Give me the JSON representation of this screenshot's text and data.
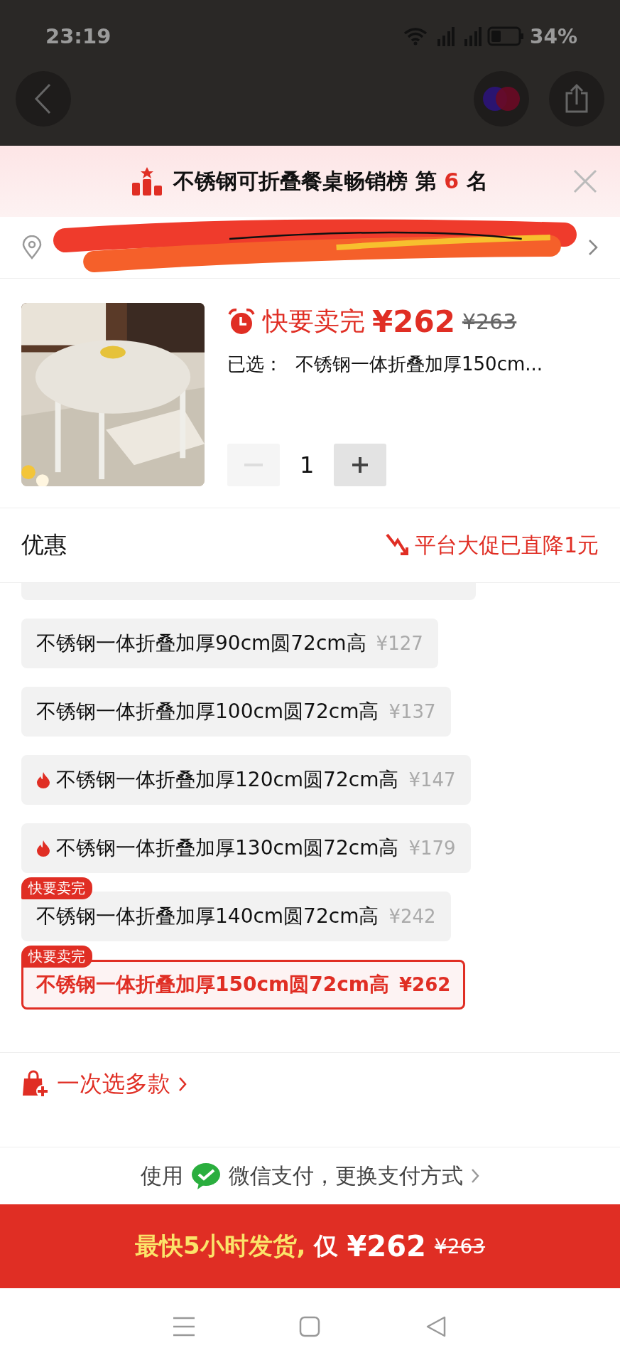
{
  "status_bar": {
    "time": "23:19",
    "battery": "34%"
  },
  "banner": {
    "title": "不锈钢可折叠餐桌畅销榜",
    "rank_prefix": "第",
    "rank": "6",
    "rank_suffix": "名"
  },
  "product": {
    "stock_note": "快要卖完",
    "price": "¥262",
    "original_price": "¥263",
    "selected_label": "已选：",
    "selected_value": "不锈钢一体折叠加厚150cm...",
    "quantity": "1",
    "decrease_disabled": true
  },
  "promo": {
    "label": "优惠",
    "note": "平台大促已直降1元"
  },
  "options": [
    {
      "label": "不锈钢一体折叠加厚90cm圆72cm高",
      "price": "¥127",
      "hot": false,
      "selected": false
    },
    {
      "label": "不锈钢一体折叠加厚100cm圆72cm高",
      "price": "¥137",
      "hot": false,
      "selected": false
    },
    {
      "label": "不锈钢一体折叠加厚120cm圆72cm高",
      "price": "¥147",
      "hot": true,
      "selected": false
    },
    {
      "label": "不锈钢一体折叠加厚130cm圆72cm高",
      "price": "¥179",
      "hot": true,
      "selected": false
    },
    {
      "label": "不锈钢一体折叠加厚140cm圆72cm高",
      "price": "¥242",
      "hot": false,
      "badge": "快要卖完",
      "selected": false
    },
    {
      "label": "不锈钢一体折叠加厚150cm圆72cm高",
      "price": "¥262",
      "hot": false,
      "badge": "快要卖完",
      "selected": true
    }
  ],
  "multi_select": "一次选多款",
  "payment": {
    "prefix": "使用",
    "text": "微信支付，更换支付方式"
  },
  "cta": {
    "lead": "最快5小时发货,",
    "only": "仅",
    "price": "¥262",
    "original_price": "¥263"
  }
}
